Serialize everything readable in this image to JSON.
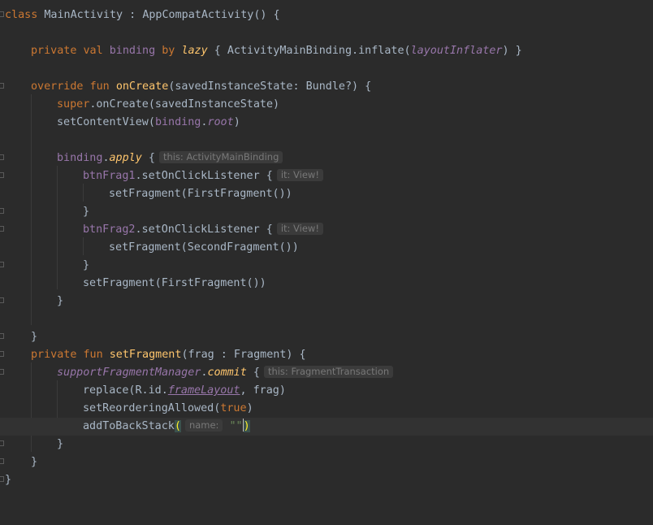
{
  "hints": {
    "this_activity_binding": "this: ActivityMainBinding",
    "it_view": "it: View!",
    "this_fragment_transaction": "this: FragmentTransaction",
    "name": "name:"
  },
  "tokens": {
    "class": "class",
    "main_activity": "MainActivity",
    "colon": " : ",
    "appcompat": "AppCompatActivity() {",
    "private": "private",
    "val": "val",
    "binding": "binding",
    "by": "by",
    "lazy": "lazy",
    "lazy_open": " { ActivityMainBinding.inflate(",
    "layout_inflater": "layoutInflater",
    "lazy_close": ") }",
    "override": "override",
    "fun": "fun",
    "on_create": "onCreate",
    "on_create_params": "(savedInstanceState: Bundle?) {",
    "super": "super",
    "super_call": ".onCreate(savedInstanceState)",
    "set_content_view": "setContentView(",
    "binding_ref": "binding",
    "dot": ".",
    "root": "root",
    "close_paren": ")",
    "apply": "apply",
    "open_brace": " {",
    "btn_frag1": "btnFrag1",
    "set_click_listener": ".setOnClickListener {",
    "set_first_fragment": "setFragment(FirstFragment())",
    "close_brace": "}",
    "btn_frag2": "btnFrag2",
    "set_second_fragment": "setFragment(SecondFragment())",
    "set_fragment": "setFragment",
    "set_fragment_params": "(frag : Fragment) {",
    "support_fragment_manager": "supportFragmentManager",
    "commit": "commit",
    "replace_open": "replace(R.id.",
    "frame_layout": "frameLayout",
    "replace_close": ", frag)",
    "set_reordering_open": "setReorderingAllowed(",
    "true": "true",
    "add_to_back_stack": "addToBackStack",
    "open_paren": "(",
    "empty_string": "\"\"",
    "final_brace": "}"
  }
}
